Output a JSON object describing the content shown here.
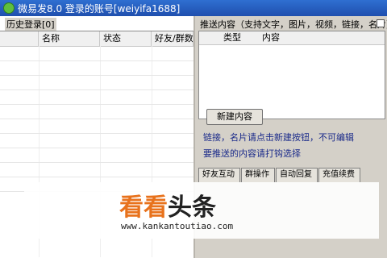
{
  "window": {
    "title": "微易发8.0  登录的账号[weiyifa1688]"
  },
  "history": {
    "label": "历史登录[0]",
    "columns": [
      "名称",
      "状态",
      "好友/群数"
    ]
  },
  "push": {
    "label": "推送内容（支持文字，图片，视频，链接，名片）",
    "columns": [
      "类型",
      "内容"
    ],
    "new_button": "新建内容",
    "note1": "链接，名片请点击新建按钮，不可编辑",
    "note2": "要推送的内容请打钩选择"
  },
  "tabs": [
    "好友互动",
    "群操作",
    "自动回复",
    "充值续费"
  ],
  "watermark": {
    "main_part1": "看看",
    "main_part2": "头条",
    "url": "www.kankantoutiao.com"
  }
}
